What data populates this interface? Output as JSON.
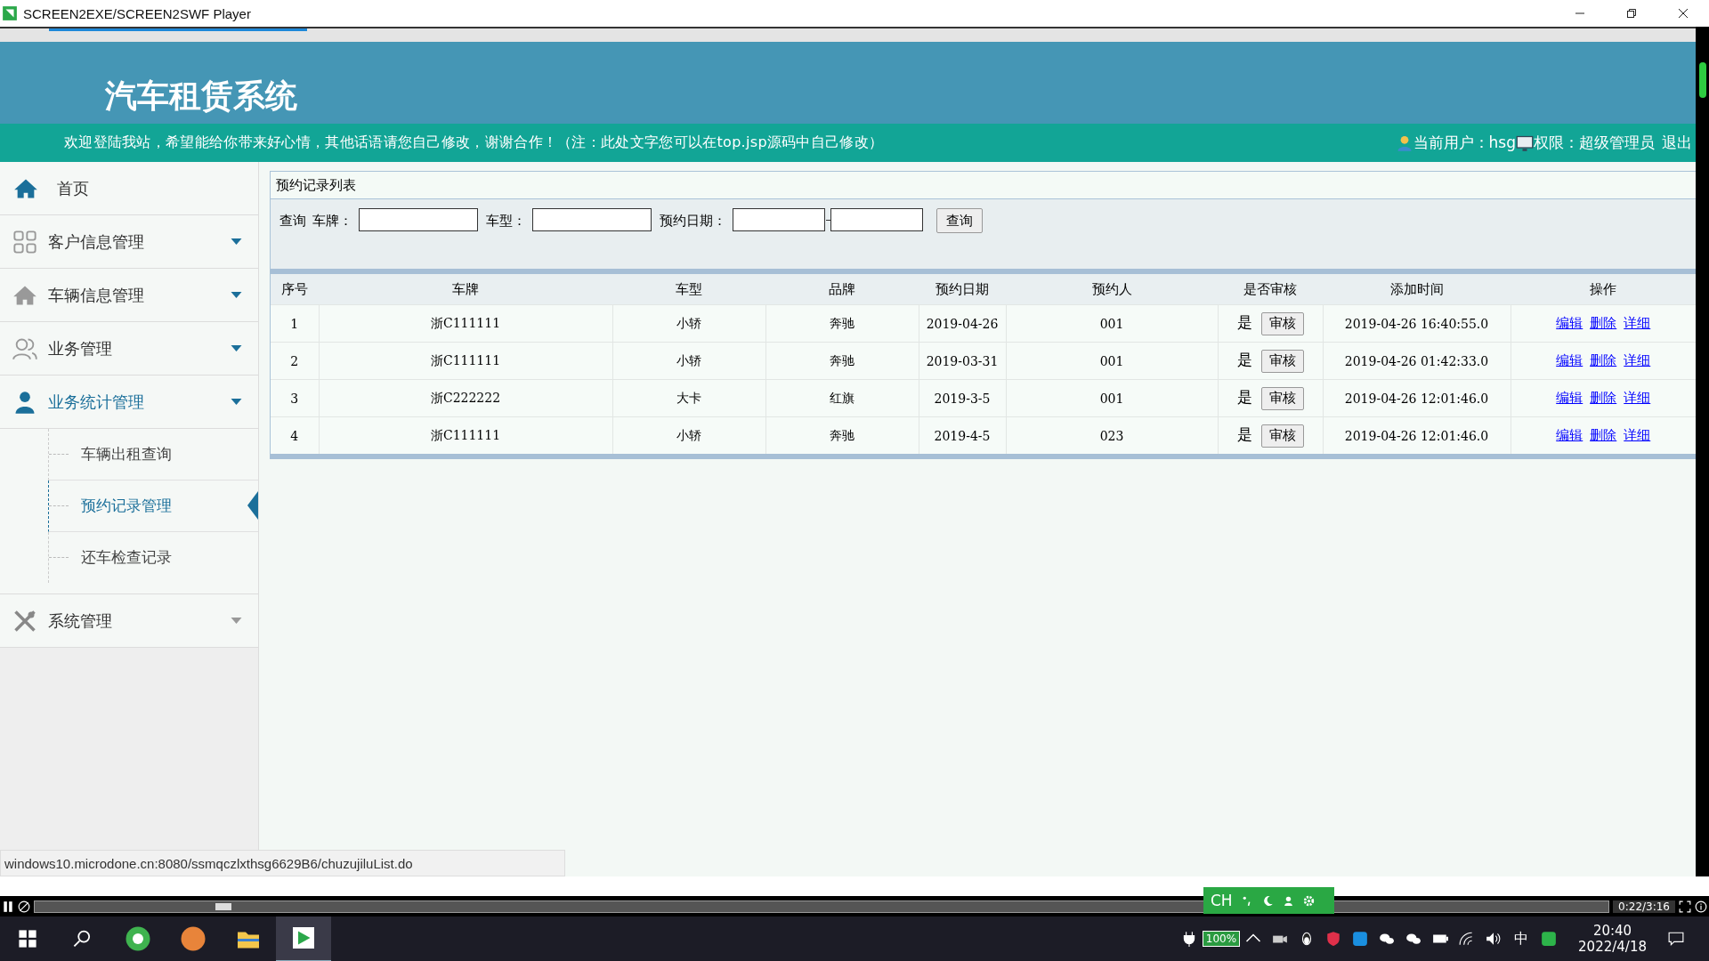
{
  "window": {
    "title": "SCREEN2EXE/SCREEN2SWF Player"
  },
  "header": {
    "title": "汽车租赁系统",
    "welcome": "欢迎登陆我站，希望能给你带来好心情，其他话语请您自己修改，谢谢合作！（注：此处文字您可以在top.jsp源码中自己修改）",
    "user": "当前用户：hsg",
    "role": "权限：超级管理员",
    "logout": "退出"
  },
  "sidebar": {
    "items": [
      {
        "label": "首页",
        "kind": "home",
        "expanded": false
      },
      {
        "label": "客户信息管理",
        "kind": "menu",
        "expanded": false
      },
      {
        "label": "车辆信息管理",
        "kind": "menu",
        "expanded": false
      },
      {
        "label": "业务管理",
        "kind": "menu",
        "expanded": false
      },
      {
        "label": "业务统计管理",
        "kind": "menu",
        "expanded": true,
        "children": [
          {
            "label": "车辆出租查询",
            "selected": false
          },
          {
            "label": "预约记录管理",
            "selected": true
          },
          {
            "label": "还车检查记录",
            "selected": false
          }
        ]
      },
      {
        "label": "系统管理",
        "kind": "menu",
        "expanded": false
      }
    ]
  },
  "panel": {
    "title": "预约记录列表",
    "search_label": "查询",
    "fields": [
      {
        "label": "车牌："
      },
      {
        "label": "车型："
      },
      {
        "label": "预约日期：",
        "range": true
      }
    ],
    "search_button": "查询"
  },
  "table": {
    "columns": [
      "序号",
      "车牌",
      "车型",
      "品牌",
      "预约日期",
      "预约人",
      "是否审核",
      "添加时间",
      "操作"
    ],
    "rows": [
      {
        "no": "1",
        "plate": "浙C111111",
        "type": "小轿",
        "brand": "奔驰",
        "date": "2019-04-26",
        "person": "001",
        "audited": "是",
        "audit_button": "审核",
        "added": "2019-04-26 16:40:55.0",
        "actions": [
          "编辑",
          "删除",
          "详细"
        ]
      },
      {
        "no": "2",
        "plate": "浙C111111",
        "type": "小轿",
        "brand": "奔驰",
        "date": "2019-03-31",
        "person": "001",
        "audited": "是",
        "audit_button": "审核",
        "added": "2019-04-26 01:42:33.0",
        "actions": [
          "编辑",
          "删除",
          "详细"
        ]
      },
      {
        "no": "3",
        "plate": "浙C222222",
        "type": "大卡",
        "brand": "红旗",
        "date": "2019-3-5",
        "person": "001",
        "audited": "是",
        "audit_button": "审核",
        "added": "2019-04-26 12:01:46.0",
        "actions": [
          "编辑",
          "删除",
          "详细"
        ]
      },
      {
        "no": "4",
        "plate": "浙C111111",
        "type": "小轿",
        "brand": "奔驰",
        "date": "2019-4-5",
        "person": "023",
        "audited": "是",
        "audit_button": "审核",
        "added": "2019-04-26 12:01:46.0",
        "actions": [
          "编辑",
          "删除",
          "详细"
        ]
      }
    ]
  },
  "status_url": "windows10.microdone.cn:8080/ssmqczlxthsg6629B6/chuzujiluList.do",
  "player": {
    "level": 0.12,
    "time": "0:22/3:16"
  },
  "ime_bar": {
    "label": "CH"
  },
  "taskbar": {
    "battery": "100%",
    "ime": "中",
    "time": "20:40",
    "date": "2022/4/18"
  }
}
